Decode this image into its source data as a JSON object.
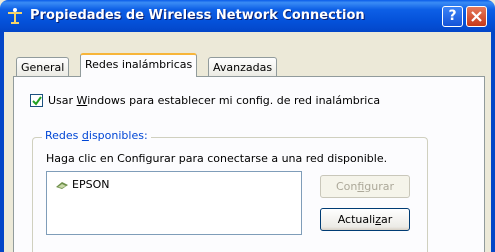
{
  "window": {
    "title": "Propiedades de Wireless Network Connection",
    "help_label": "?",
    "close_label": "×"
  },
  "tabs": [
    {
      "label": "General",
      "active": false
    },
    {
      "label": "Redes inalámbricas",
      "active": true
    },
    {
      "label": "Avanzadas",
      "active": false
    }
  ],
  "settings": {
    "use_windows_checkbox": {
      "checked": true,
      "label_pre": "Usar ",
      "label_accel": "W",
      "label_post": "indows para establecer mi config. de red inalámbrica"
    }
  },
  "available_networks": {
    "legend_pre": "Redes ",
    "legend_accel": "d",
    "legend_post": "isponibles:",
    "description": "Haga clic en Configurar para conectarse a una red disponible.",
    "networks": [
      {
        "name": "EPSON",
        "icon": "wireless-network-icon"
      }
    ],
    "configure_button": {
      "pre": "Con",
      "accel": "f",
      "post": "igurar",
      "enabled": false
    },
    "refresh_button": {
      "pre": "Actuali",
      "accel": "z",
      "post": "ar",
      "enabled": true
    }
  },
  "colors": {
    "titlebar": "#0450d8",
    "tab_highlight": "#f7b53a",
    "group_legend": "#0046d5"
  }
}
